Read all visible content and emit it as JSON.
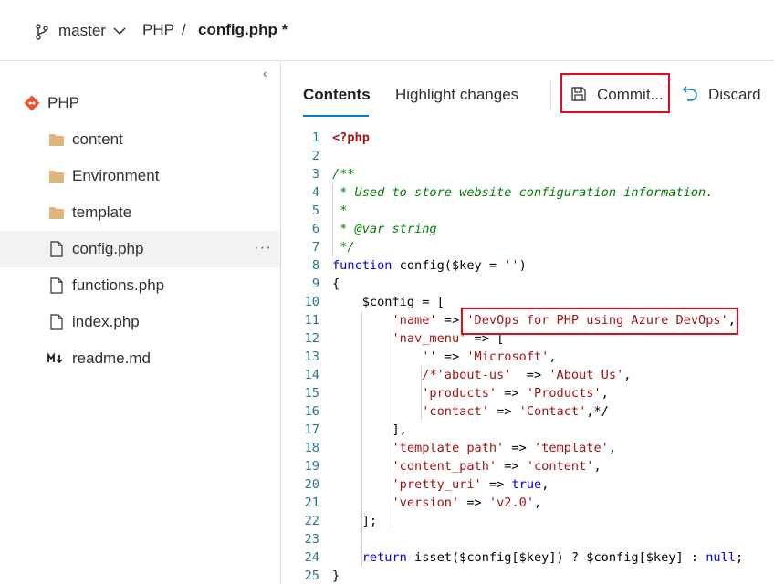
{
  "breadcrumb": {
    "branch": "master",
    "repo": "PHP",
    "separator": "/",
    "file": "config.php *"
  },
  "sidebar": {
    "collapse_glyph": "‹",
    "more_glyph": "···",
    "items": [
      {
        "label": "PHP",
        "icon": "git-repo-icon"
      },
      {
        "label": "content",
        "icon": "folder-icon"
      },
      {
        "label": "Environment",
        "icon": "folder-icon"
      },
      {
        "label": "template",
        "icon": "folder-icon"
      },
      {
        "label": "config.php",
        "icon": "file-icon",
        "selected": true
      },
      {
        "label": "functions.php",
        "icon": "file-icon"
      },
      {
        "label": "index.php",
        "icon": "file-icon"
      },
      {
        "label": "readme.md",
        "icon": "markdown-icon"
      }
    ]
  },
  "toolbar": {
    "tab_contents": "Contents",
    "tab_highlight": "Highlight changes",
    "commit_label": "Commit...",
    "discard_label": "Discard"
  },
  "editor": {
    "line_numbers": [
      "1",
      "2",
      "3",
      "4",
      "5",
      "6",
      "7",
      "8",
      "9",
      "10",
      "11",
      "12",
      "13",
      "14",
      "15",
      "16",
      "17",
      "18",
      "19",
      "20",
      "21",
      "22",
      "23",
      "24",
      "25"
    ]
  },
  "colors": {
    "accent": "#0078d4",
    "highlight_border": "#e00b1c",
    "git_orange": "#f05133",
    "folder": "#dcb67a",
    "selected_bg": "#f3f2f1"
  }
}
